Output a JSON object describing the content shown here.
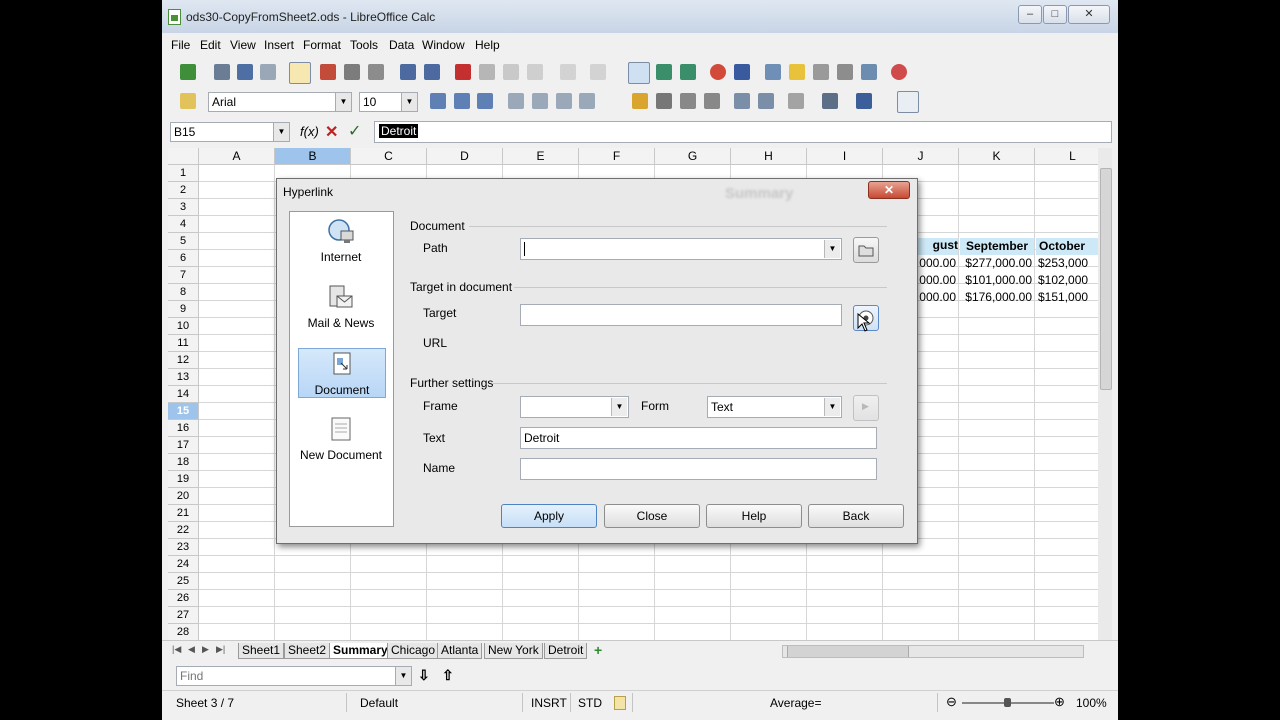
{
  "window": {
    "title": "ods30-CopyFromSheet2.ods - LibreOffice Calc",
    "controls": [
      "–",
      "□",
      "✕"
    ]
  },
  "menu": [
    "File",
    "Edit",
    "View",
    "Insert",
    "Format",
    "Tools",
    "Data",
    "Window",
    "Help"
  ],
  "formatting": {
    "font_name": "Arial",
    "font_size": "10"
  },
  "formula_bar": {
    "cell_ref": "B15",
    "content": "Detroit"
  },
  "grid": {
    "columns": [
      "A",
      "B",
      "C",
      "D",
      "E",
      "F",
      "G",
      "H",
      "I",
      "J",
      "K",
      "L"
    ],
    "rows": [
      "1",
      "2",
      "3",
      "4",
      "5",
      "6",
      "7",
      "8",
      "9",
      "10",
      "11",
      "12",
      "13",
      "14",
      "15",
      "16",
      "17",
      "18",
      "19",
      "20",
      "21",
      "22",
      "23",
      "24",
      "25",
      "26",
      "27",
      "28"
    ],
    "selected_column": "B",
    "selected_row": "15",
    "visible_cells": {
      "J5": "gust",
      "K5": "September",
      "L5": "October",
      "J6": "000.00",
      "K6": "$277,000.00",
      "L6": "$253,000",
      "J7": "000.00",
      "K7": "$101,000.00",
      "L7": "$102,000",
      "J8": "000.00",
      "K8": "$176,000.00",
      "L8": "$151,000"
    }
  },
  "sheet_tabs": [
    "Sheet1",
    "Sheet2",
    "Summary",
    "Chicago",
    "Atlanta",
    "New York",
    "Detroit"
  ],
  "active_sheet": "Summary",
  "find": {
    "placeholder": "Find"
  },
  "status": {
    "sheet": "Sheet 3 / 7",
    "style": "Default",
    "mode": "INSRT",
    "selection": "STD",
    "sum": "Average=",
    "zoom": "100%"
  },
  "dialog": {
    "title": "Hyperlink",
    "ghost_text": "Summary",
    "close_label": "✕",
    "categories": [
      "Internet",
      "Mail & News",
      "Document",
      "New Document"
    ],
    "selected_category": "Document",
    "document_group": "Document",
    "path_label": "Path",
    "path_value": "",
    "target_group": "Target in document",
    "target_label": "Target",
    "target_value": "",
    "url_label": "URL",
    "further_group": "Further settings",
    "frame_label": "Frame",
    "frame_value": "",
    "form_label": "Form",
    "form_value": "Text",
    "text_label": "Text",
    "text_value": "Detroit",
    "name_label": "Name",
    "name_value": "",
    "buttons": {
      "apply": "Apply",
      "close": "Close",
      "help": "Help",
      "back": "Back"
    }
  }
}
